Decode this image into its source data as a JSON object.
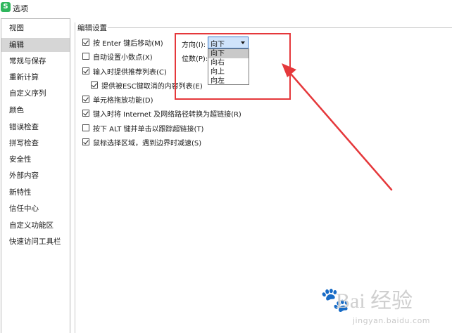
{
  "window": {
    "title": "选项",
    "app_icon_letter": "S"
  },
  "sidebar": {
    "items": [
      {
        "label": "视图"
      },
      {
        "label": "编辑",
        "active": true
      },
      {
        "label": "常规与保存"
      },
      {
        "label": "重新计算"
      },
      {
        "label": "自定义序列"
      },
      {
        "label": "颜色"
      },
      {
        "label": "错误检查"
      },
      {
        "label": "拼写检查"
      },
      {
        "label": "安全性"
      },
      {
        "label": "外部内容"
      },
      {
        "label": "新特性"
      },
      {
        "label": "信任中心"
      },
      {
        "label": "自定义功能区"
      },
      {
        "label": "快速访问工具栏"
      }
    ]
  },
  "edit_settings": {
    "group_title": "编辑设置",
    "options": [
      {
        "label": "按 Enter 键后移动(M)",
        "checked": true
      },
      {
        "label": "自动设置小数点(X)",
        "checked": false
      },
      {
        "label": "输入时提供推荐列表(C)",
        "checked": true
      },
      {
        "label": "提供被ESC键取消的内容列表(E)",
        "checked": true
      },
      {
        "label": "单元格拖放功能(D)",
        "checked": true
      },
      {
        "label": "键入时将 Internet 及网络路径转换为超链接(R)",
        "checked": true
      },
      {
        "label": "按下 ALT 键并单击以跟踪超链接(T)",
        "checked": false
      },
      {
        "label": "鼠标选择区域，遇到边界时减速(S)",
        "checked": true
      }
    ],
    "direction_label": "方向(I):",
    "direction_value": "向下",
    "digits_label": "位数(P):",
    "direction_options": [
      {
        "label": "向下",
        "selected": true
      },
      {
        "label": "向右"
      },
      {
        "label": "向上"
      },
      {
        "label": "向左"
      }
    ]
  },
  "annotation": {
    "color": "#e5383b"
  },
  "watermark": {
    "brand": "Bai 经验",
    "url": "jingyan.baidu.com"
  }
}
